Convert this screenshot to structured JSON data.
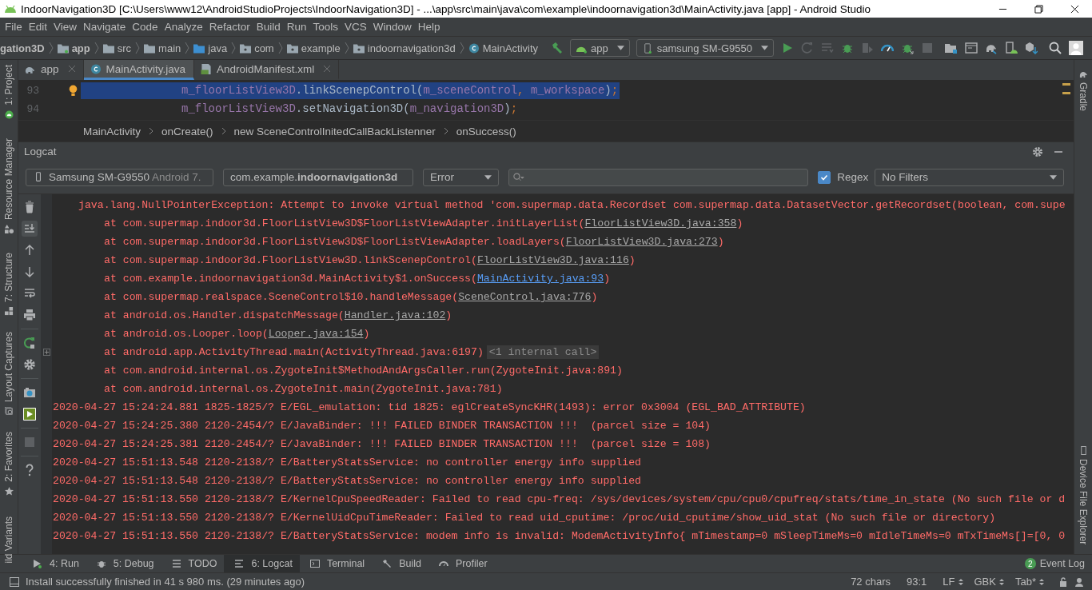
{
  "window": {
    "title": "IndoorNavigation3D [C:\\Users\\www12\\AndroidStudioProjects\\IndoorNavigation3D] - ...\\app\\src\\main\\java\\com\\example\\indoornavigation3d\\MainActivity.java [app] - Android Studio"
  },
  "menu": [
    "File",
    "Edit",
    "View",
    "Navigate",
    "Code",
    "Analyze",
    "Refactor",
    "Build",
    "Run",
    "Tools",
    "VCS",
    "Window",
    "Help"
  ],
  "breadcrumb": [
    {
      "label": "gation3D",
      "kind": "project"
    },
    {
      "label": "app",
      "kind": "module"
    },
    {
      "label": "src",
      "kind": "folder"
    },
    {
      "label": "main",
      "kind": "folder"
    },
    {
      "label": "java",
      "kind": "source"
    },
    {
      "label": "com",
      "kind": "package"
    },
    {
      "label": "example",
      "kind": "package"
    },
    {
      "label": "indoornavigation3d",
      "kind": "package"
    },
    {
      "label": "MainActivity",
      "kind": "class"
    }
  ],
  "run_config": "app",
  "device": "samsung SM-G9550",
  "toolbar_actions": [
    {
      "kind": "run",
      "disabled": false
    },
    {
      "kind": "rerun",
      "disabled": true
    },
    {
      "kind": "apply",
      "disabled": true
    },
    {
      "kind": "debug",
      "disabled": false
    },
    {
      "kind": "attach",
      "disabled": true
    },
    {
      "kind": "profile",
      "disabled": false
    },
    {
      "kind": "debugattach",
      "disabled": false
    },
    {
      "kind": "stop",
      "disabled": true
    },
    {
      "kind": "structure",
      "disabled": false
    },
    {
      "kind": "screen",
      "disabled": false
    },
    {
      "kind": "sync",
      "disabled": false
    },
    {
      "kind": "avd",
      "disabled": false
    },
    {
      "kind": "sdk",
      "disabled": false
    }
  ],
  "left_tools": [
    {
      "label": "1: Project",
      "kind": "project"
    },
    {
      "label": "Resource Manager",
      "kind": "resource"
    },
    {
      "label": "7: Structure",
      "kind": "structure"
    },
    {
      "label": "Layout Captures",
      "kind": "captures"
    },
    {
      "label": "2: Favorites",
      "kind": "favorites"
    },
    {
      "label": "ild Variants",
      "kind": "variants"
    }
  ],
  "right_tools": [
    {
      "label": "Gradle",
      "kind": "gradle"
    },
    {
      "label": "Device File Explorer",
      "kind": "explorer"
    }
  ],
  "editor_tabs": [
    {
      "label": "app",
      "kind": "module",
      "selected": false
    },
    {
      "label": "MainActivity.java",
      "kind": "class",
      "selected": true
    },
    {
      "label": "AndroidManifest.xml",
      "kind": "manifest",
      "selected": false
    }
  ],
  "code_lines": [
    {
      "number": "93",
      "highlighted": true,
      "bulb": true,
      "segments": [
        {
          "kind": "field",
          "text": "m_floorListView3D"
        },
        {
          "kind": "plain",
          "text": ".linkScenepControl("
        },
        {
          "kind": "field",
          "text": "m_sceneControl"
        },
        {
          "kind": "keyword",
          "text": ", "
        },
        {
          "kind": "field",
          "text": "m_workspace"
        },
        {
          "kind": "plain",
          "text": ")"
        },
        {
          "kind": "keyword",
          "text": ";"
        }
      ]
    },
    {
      "number": "94",
      "highlighted": false,
      "bulb": false,
      "segments": [
        {
          "kind": "field",
          "text": "m_floorListView3D"
        },
        {
          "kind": "plain",
          "text": ".setNavigation3D("
        },
        {
          "kind": "field",
          "text": "m_navigation3D"
        },
        {
          "kind": "plain",
          "text": ")"
        },
        {
          "kind": "keyword",
          "text": ";"
        }
      ]
    }
  ],
  "code_breadcrumb": [
    "MainActivity",
    "onCreate()",
    "new SceneControlInitedCallBackListenner",
    "onSuccess()"
  ],
  "logcat": {
    "title": "Logcat",
    "device": "Samsung SM-G9550",
    "device_version": "Android 7.",
    "package": "com.example.**indoornavigation3d**",
    "level": "Error",
    "regex": {
      "label": "Regex",
      "checked": true
    },
    "filter": "No Filters",
    "tools": [
      {
        "kind": "clear",
        "on": false
      },
      {
        "kind": "scroll",
        "on": true
      },
      {
        "kind": "up",
        "on": false
      },
      {
        "kind": "down",
        "on": false
      },
      {
        "kind": "wrap",
        "on": false
      },
      {
        "kind": "print",
        "on": false
      },
      {
        "kind": "restart",
        "on": false
      },
      {
        "kind": "settings",
        "on": false
      },
      {
        "kind": "camera",
        "on": false
      },
      {
        "kind": "record",
        "on": false
      },
      {
        "kind": "stop",
        "on": false
      },
      {
        "kind": "help",
        "on": false
      }
    ],
    "lines": [
      {
        "kind": "exception",
        "text": "java.lang.NullPointerException: Attempt to invoke virtual method 'com.supermap.data.Recordset com.supermap.data.DatasetVector.getRecordset(boolean, com.supe"
      },
      {
        "kind": "trace",
        "text": "at com.supermap.indoor3d.FloorListView3D$FloorListViewAdapter.initLayerList(",
        "link": "FloorListView3D.java:358",
        "in_project": false,
        "tail": ")"
      },
      {
        "kind": "trace",
        "text": "at com.supermap.indoor3d.FloorListView3D$FloorListViewAdapter.loadLayers(",
        "link": "FloorListView3D.java:273",
        "in_project": false,
        "tail": ")"
      },
      {
        "kind": "trace",
        "text": "at com.supermap.indoor3d.FloorListView3D.linkScenepControl(",
        "link": "FloorListView3D.java:116",
        "in_project": false,
        "tail": ")"
      },
      {
        "kind": "trace",
        "text": "at com.example.indoornavigation3d.MainActivity$1.onSuccess(",
        "link": "MainActivity.java:93",
        "in_project": true,
        "tail": ")"
      },
      {
        "kind": "trace",
        "text": "at com.supermap.realspace.SceneControl$10.handleMessage(",
        "link": "SceneControl.java:776",
        "in_project": false,
        "tail": ")"
      },
      {
        "kind": "trace",
        "text": "at android.os.Handler.dispatchMessage(",
        "link": "Handler.java:102",
        "in_project": false,
        "tail": ")"
      },
      {
        "kind": "trace",
        "text": "at android.os.Looper.loop(",
        "link": "Looper.java:154",
        "in_project": false,
        "tail": ")"
      },
      {
        "kind": "trace",
        "text": "at android.app.ActivityThread.main(ActivityThread.java:6197)",
        "folded": "<1 internal call>"
      },
      {
        "kind": "trace",
        "text": "at com.android.internal.os.ZygoteInit$MethodAndArgsCaller.run(ZygoteInit.java:891)"
      },
      {
        "kind": "trace",
        "text": "at com.android.internal.os.ZygoteInit.main(ZygoteInit.java:781)"
      },
      {
        "kind": "entry",
        "text": "2020-04-27 15:24:24.881 1825-1825/? E/EGL_emulation: tid 1825: eglCreateSyncKHR(1493): error 0x3004 (EGL_BAD_ATTRIBUTE)"
      },
      {
        "kind": "entry",
        "text": "2020-04-27 15:24:25.380 2120-2454/? E/JavaBinder: !!! FAILED BINDER TRANSACTION !!!  (parcel size = 104)"
      },
      {
        "kind": "entry",
        "text": "2020-04-27 15:24:25.381 2120-2454/? E/JavaBinder: !!! FAILED BINDER TRANSACTION !!!  (parcel size = 108)"
      },
      {
        "kind": "entry",
        "text": "2020-04-27 15:51:13.548 2120-2138/? E/BatteryStatsService: no controller energy info supplied"
      },
      {
        "kind": "entry",
        "text": "2020-04-27 15:51:13.548 2120-2138/? E/BatteryStatsService: no controller energy info supplied"
      },
      {
        "kind": "entry",
        "text": "2020-04-27 15:51:13.550 2120-2138/? E/KernelCpuSpeedReader: Failed to read cpu-freq: /sys/devices/system/cpu/cpu0/cpufreq/stats/time_in_state (No such file or d"
      },
      {
        "kind": "entry",
        "text": "2020-04-27 15:51:13.550 2120-2138/? E/KernelUidCpuTimeReader: Failed to read uid_cputime: /proc/uid_cputime/show_uid_stat (No such file or directory)"
      },
      {
        "kind": "entry",
        "text": "2020-04-27 15:51:13.550 2120-2138/? E/BatteryStatsService: modem info is invalid: ModemActivityInfo{ mTimestamp=0 mSleepTimeMs=0 mIdleTimeMs=0 mTxTimeMs[]=[0, 0"
      }
    ]
  },
  "bottom_tabs": [
    {
      "label": "4: Run",
      "kind": "run",
      "selected": false
    },
    {
      "label": "5: Debug",
      "kind": "debug",
      "selected": false
    },
    {
      "label": "TODO",
      "kind": "todo",
      "selected": false
    },
    {
      "label": "6: Logcat",
      "kind": "logcat",
      "selected": true
    },
    {
      "label": "Terminal",
      "kind": "terminal",
      "selected": false
    },
    {
      "label": "Build",
      "kind": "build",
      "selected": false
    },
    {
      "label": "Profiler",
      "kind": "profiler",
      "selected": false
    }
  ],
  "event_log": {
    "label": "Event Log",
    "count": "2"
  },
  "status": {
    "message": "Install successfully finished in 41 s 980 ms. (29 minutes ago)",
    "chars": "72 chars",
    "position": "93:1",
    "line_separator": "LF",
    "encoding": "GBK",
    "indent": "Tab*"
  }
}
